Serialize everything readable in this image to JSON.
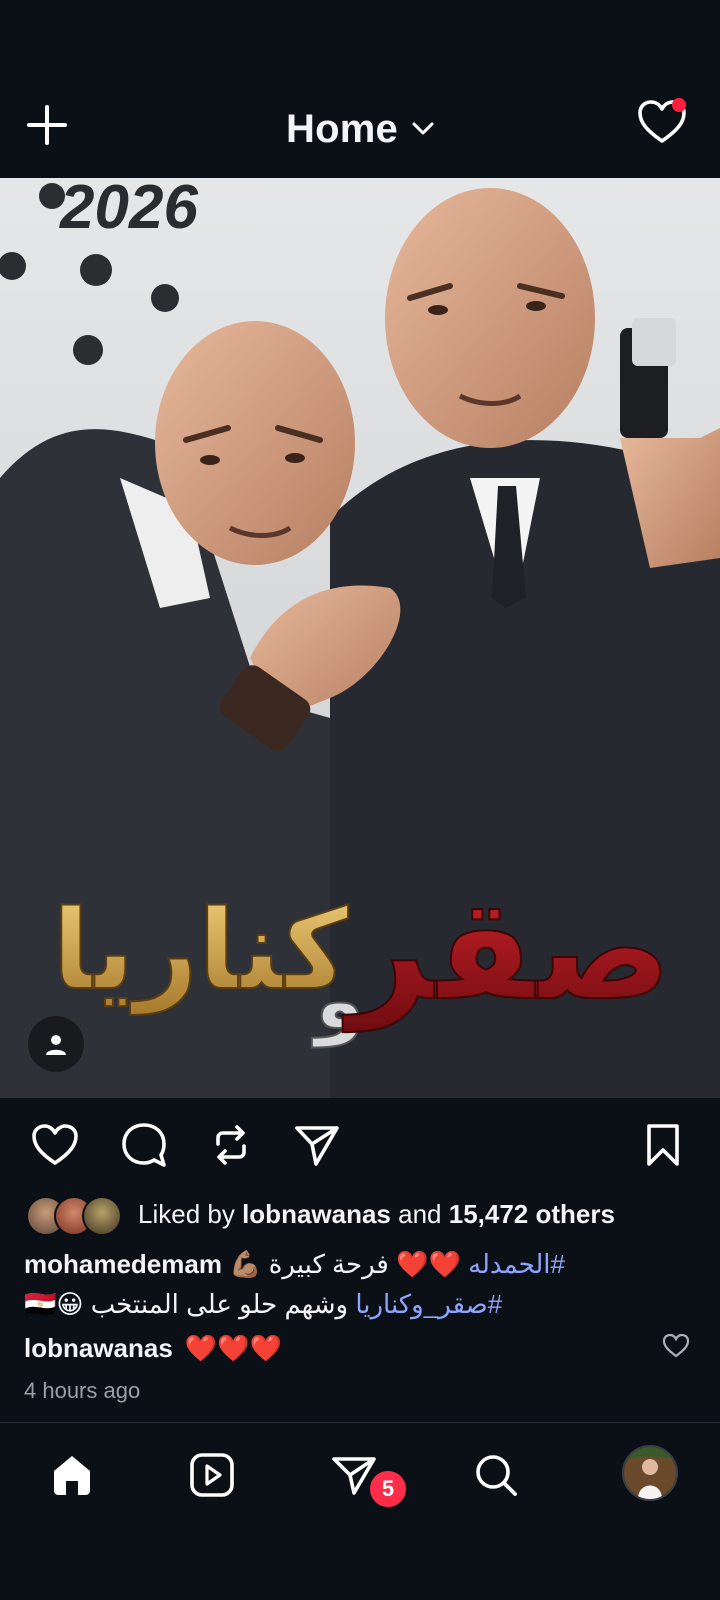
{
  "topbar": {
    "title": "Home",
    "add_icon": "plus-icon",
    "chevron_icon": "chevron-down-icon",
    "heart_icon": "heart-outline-icon",
    "notification_dot_color": "#ff1f3d"
  },
  "post": {
    "image_year_text": "2026",
    "image_title_red": "صقر",
    "image_title_connector": "و",
    "image_title_gold": "كناريا",
    "profile_icon": "person-icon",
    "actions": {
      "like_icon": "heart-icon",
      "comment_icon": "comment-icon",
      "repost_icon": "repost-icon",
      "share_icon": "send-icon",
      "save_icon": "bookmark-icon"
    },
    "likes": {
      "prefix": "Liked by ",
      "user": "lobnawanas",
      "middle": " and ",
      "count": "15,472 others"
    },
    "caption": {
      "user": "mohamedemam",
      "line1_hashtag": "#الحمدله",
      "line1_text": "❤️❤️ فرحة كبيرة 💪🏽",
      "line2_hashtag": "#صقر_وكناريا",
      "line2_text": " وشهم حلو على المنتخب 😀🇪🇬"
    },
    "comment": {
      "user": "lobnawanas",
      "text": "❤️❤️❤️"
    },
    "time": "4 hours ago"
  },
  "bottom_nav": {
    "items": [
      "home-icon",
      "reels-icon",
      "direct-icon",
      "search-icon",
      "profile-avatar"
    ],
    "direct_badge": "5",
    "badge_color": "#ff2d4a"
  }
}
